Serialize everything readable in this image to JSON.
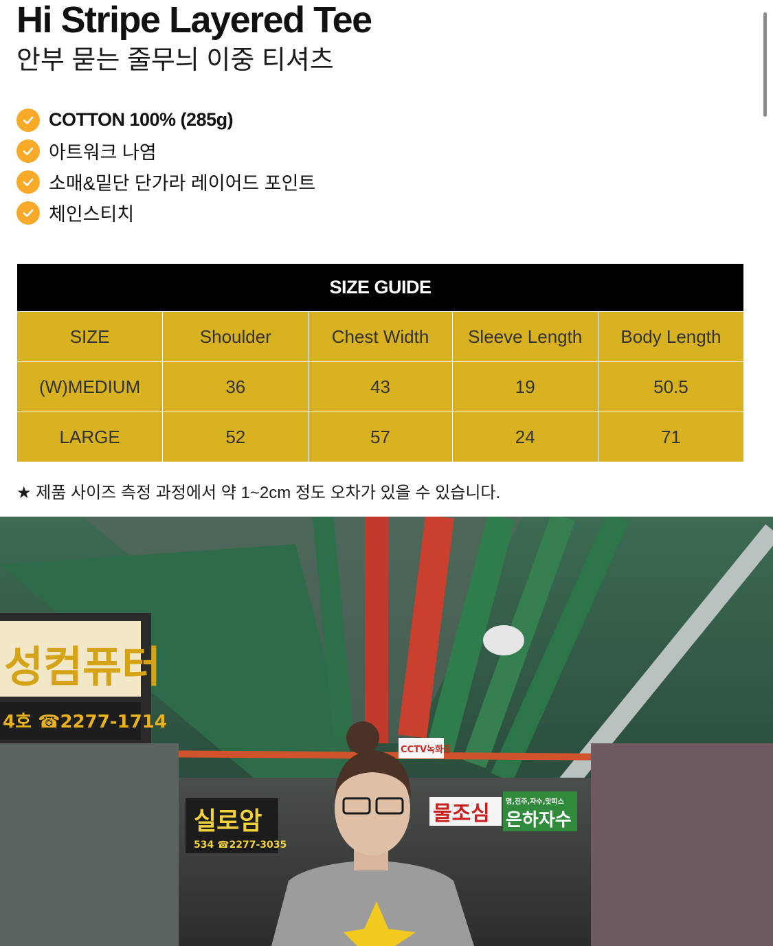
{
  "product": {
    "title": "Hi Stripe Layered Tee",
    "subtitle": "안부 묻는 줄무늬 이중 티셔츠"
  },
  "features": [
    "COTTON 100% (285g)",
    "아트워크 나염",
    "소매&밑단 단가라 레이어드 포인트",
    "체인스티치"
  ],
  "size_guide": {
    "title": "SIZE GUIDE",
    "headers": [
      "SIZE",
      "Shoulder",
      "Chest Width",
      "Sleeve Length",
      "Body Length"
    ],
    "rows": [
      [
        "(W)MEDIUM",
        "36",
        "43",
        "19",
        "50.5"
      ],
      [
        "LARGE",
        "52",
        "57",
        "24",
        "71"
      ]
    ]
  },
  "note": "★ 제품 사이즈 측정 과정에서 약 1~2cm 정도 오차가 있을 수 있습니다.",
  "photo_signs": {
    "sign_left": "성컴퓨터",
    "sign_left_sub": "4호 ☎2277-1714",
    "sign_center": "실로암",
    "sign_center_sub": "534 ☎2277-3035",
    "sign_cctv": "CCTV녹화중",
    "sign_red": "물조심",
    "sign_green": "은하자수",
    "sign_green_top": "명,진주,자수,맛피스"
  },
  "colors": {
    "check": "#f7a928",
    "table_header_bg": "#000000",
    "table_body_bg": "#d9b222"
  }
}
